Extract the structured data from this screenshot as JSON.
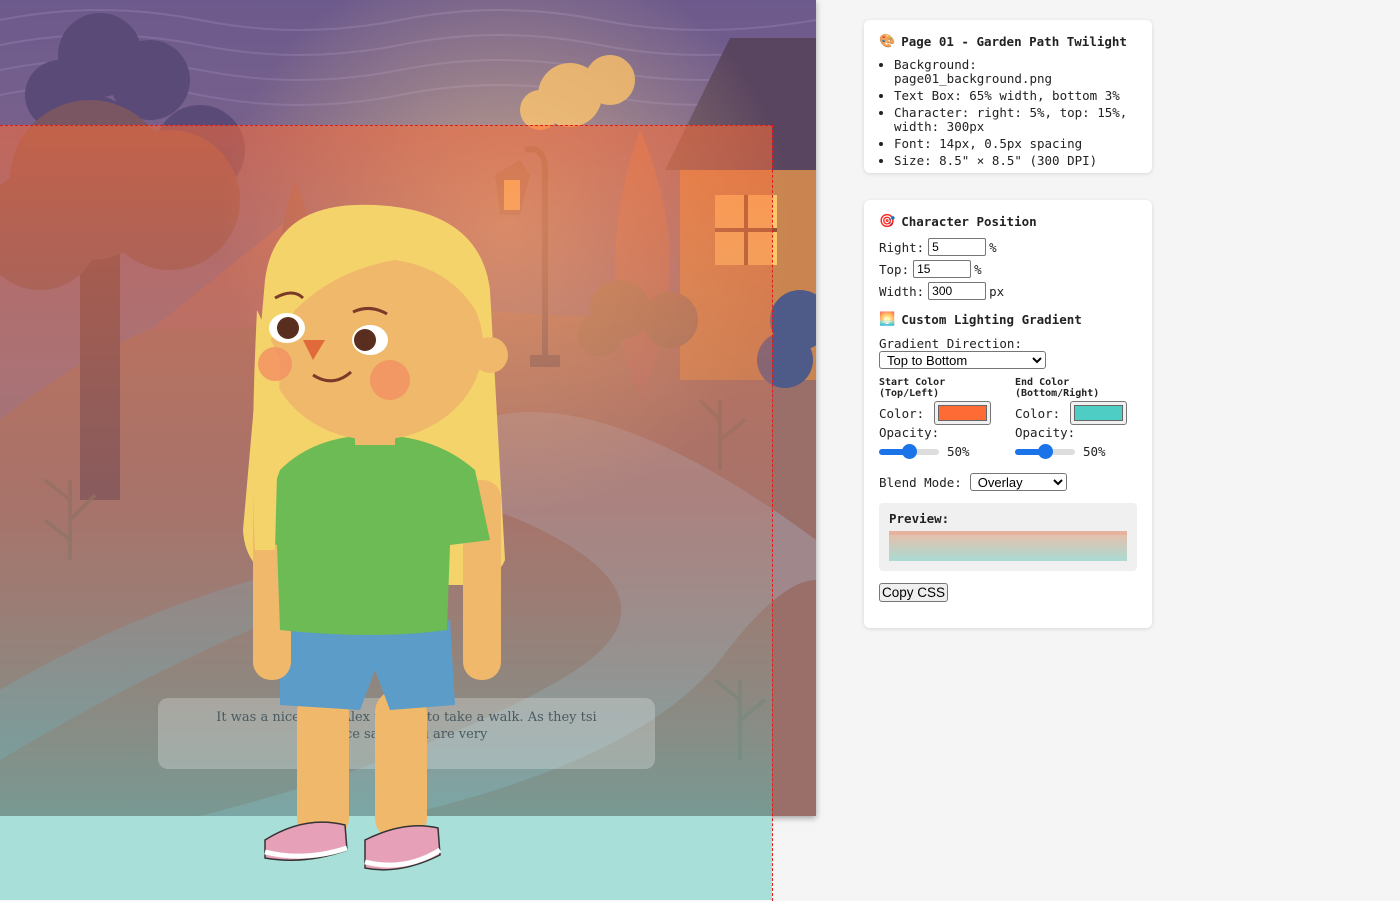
{
  "info_panel": {
    "icon": "palette-icon",
    "title": "Page 01 - Garden Path Twilight",
    "items": [
      "Background: page01_background.png",
      "Text Box: 65% width, bottom 3%",
      "Character: right: 5%, top: 15%, width: 300px",
      "Font: 14px, 0.5px spacing",
      "Size: 8.5\" × 8.5\" (300 DPI)"
    ]
  },
  "character_panel": {
    "icon": "target-icon",
    "title": "Character Position",
    "right_label": "Right:",
    "right_value": "5",
    "right_unit": "%",
    "top_label": "Top:",
    "top_value": "15",
    "top_unit": "%",
    "width_label": "Width:",
    "width_value": "300",
    "width_unit": "px"
  },
  "gradient_panel": {
    "icon": "sunrise-icon",
    "title": "Custom Lighting Gradient",
    "direction_label": "Gradient Direction:",
    "direction_value": "Top to Bottom",
    "start": {
      "title": "Start Color (Top/Left)",
      "color_label": "Color:",
      "color": "#ff6b35",
      "opacity_label": "Opacity:",
      "opacity_value": "50%",
      "opacity": 0.5
    },
    "end": {
      "title": "End Color (Bottom/Right)",
      "color_label": "Color:",
      "color": "#4ecdc4",
      "opacity_label": "Opacity:",
      "opacity_value": "50%",
      "opacity": 0.5
    },
    "blend_label": "Blend Mode:",
    "blend_value": "Overlay",
    "preview_label": "Preview:",
    "copy_button": "Copy CSS"
  },
  "scene": {
    "story_text": "It was a nice          in          nd Alex wanted to take a walk. As they          tsi          voice said, \"You are very"
  }
}
